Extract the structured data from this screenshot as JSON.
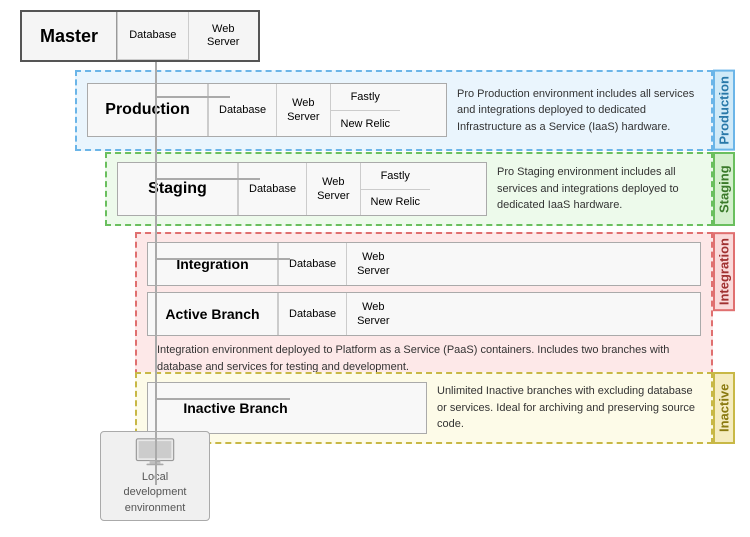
{
  "master": {
    "label": "Master",
    "components": [
      {
        "label": "Database"
      },
      {
        "label": "Web\nServer"
      }
    ]
  },
  "sections": {
    "production": {
      "label": "Production",
      "vertical_label": "Production",
      "env_box": {
        "label": "Production",
        "database": "Database",
        "webserver": "Web\nServer",
        "stack1": "Fastly",
        "stack2": "New Relic"
      },
      "description": "Pro Production environment includes all services and integrations deployed to dedicated Infrastructure as a Service (IaaS) hardware."
    },
    "staging": {
      "label": "Staging",
      "vertical_label": "Staging",
      "env_box": {
        "label": "Staging",
        "database": "Database",
        "webserver": "Web\nServer",
        "stack1": "Fastly",
        "stack2": "New Relic"
      },
      "description": "Pro Staging environment includes all services and integrations deployed to dedicated IaaS hardware."
    },
    "integration": {
      "label": "Integration",
      "vertical_label": "Integration",
      "env_box": {
        "label": "Integration",
        "database": "Database",
        "webserver": "Web\nServer"
      },
      "active_branch": {
        "label": "Active Branch",
        "database": "Database",
        "webserver": "Web\nServer"
      },
      "description": "Integration environment deployed to Platform as a Service (PaaS) containers. Includes two branches with database and services for testing and development."
    },
    "inactive": {
      "label": "Inactive Branch",
      "vertical_label": "Inactive",
      "description": "Unlimited Inactive branches with excluding database or services. Ideal for archiving and preserving source code."
    }
  },
  "local_dev": {
    "label": "Local\ndevelopment\nenvironment"
  }
}
